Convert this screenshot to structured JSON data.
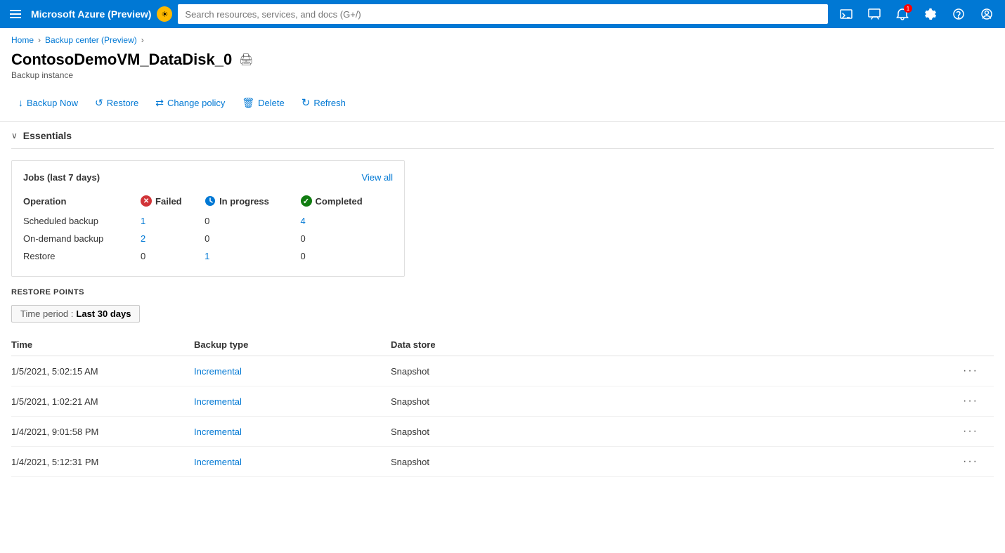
{
  "topbar": {
    "title": "Microsoft Azure (Preview)",
    "badge_icon": "☀",
    "search_placeholder": "Search resources, services, and docs (G+/)"
  },
  "topbar_icons": [
    {
      "name": "cloud-shell-icon",
      "symbol": "⌨",
      "label": "Cloud Shell"
    },
    {
      "name": "feedback-icon",
      "symbol": "⬜",
      "label": "Feedback"
    },
    {
      "name": "notifications-icon",
      "symbol": "🔔",
      "label": "Notifications",
      "badge": "1"
    },
    {
      "name": "settings-icon",
      "symbol": "⚙",
      "label": "Settings"
    },
    {
      "name": "help-icon",
      "symbol": "?",
      "label": "Help"
    },
    {
      "name": "account-icon",
      "symbol": "😊",
      "label": "Account"
    }
  ],
  "breadcrumb": {
    "items": [
      {
        "label": "Home",
        "link": true
      },
      {
        "label": "Backup center (Preview)",
        "link": true
      }
    ]
  },
  "page": {
    "title": "ContosoDemoVM_DataDisk_0",
    "subtitle": "Backup instance"
  },
  "toolbar": {
    "buttons": [
      {
        "name": "backup-now-button",
        "icon": "↓",
        "label": "Backup Now"
      },
      {
        "name": "restore-button",
        "icon": "↺",
        "label": "Restore"
      },
      {
        "name": "change-policy-button",
        "icon": "⇄",
        "label": "Change policy"
      },
      {
        "name": "delete-button",
        "icon": "🗑",
        "label": "Delete"
      },
      {
        "name": "refresh-button",
        "icon": "↻",
        "label": "Refresh"
      }
    ]
  },
  "essentials": {
    "label": "Essentials"
  },
  "jobs_card": {
    "title": "Jobs (last 7 days)",
    "view_all_label": "View all",
    "columns": [
      "Operation",
      "Failed",
      "In progress",
      "Completed"
    ],
    "rows": [
      {
        "operation": "Scheduled backup",
        "failed": "1",
        "failed_link": true,
        "in_progress": "0",
        "in_progress_link": false,
        "completed": "4",
        "completed_link": true
      },
      {
        "operation": "On-demand backup",
        "failed": "2",
        "failed_link": true,
        "in_progress": "0",
        "in_progress_link": false,
        "completed": "0",
        "completed_link": false
      },
      {
        "operation": "Restore",
        "failed": "0",
        "failed_link": false,
        "in_progress": "1",
        "in_progress_link": true,
        "completed": "0",
        "completed_link": false
      }
    ]
  },
  "restore_points": {
    "section_label": "RESTORE POINTS",
    "filter_label": "Time period",
    "filter_value": "Last 30 days",
    "columns": [
      "Time",
      "Backup type",
      "Data store"
    ],
    "rows": [
      {
        "time": "1/5/2021, 5:02:15 AM",
        "backup_type": "Incremental",
        "data_store": "Snapshot"
      },
      {
        "time": "1/5/2021, 1:02:21 AM",
        "backup_type": "Incremental",
        "data_store": "Snapshot"
      },
      {
        "time": "1/4/2021, 9:01:58 PM",
        "backup_type": "Incremental",
        "data_store": "Snapshot"
      },
      {
        "time": "1/4/2021, 5:12:31 PM",
        "backup_type": "Incremental",
        "data_store": "Snapshot"
      }
    ]
  }
}
